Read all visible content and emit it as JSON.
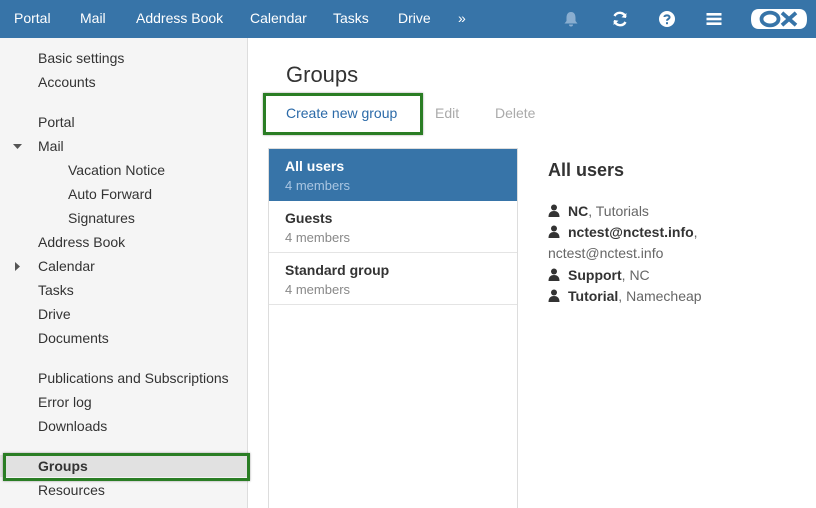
{
  "topnav": {
    "items": [
      "Portal",
      "Mail",
      "Address Book",
      "Calendar",
      "Tasks",
      "Drive"
    ],
    "more": "»"
  },
  "topicons": [
    "bell-icon",
    "refresh-icon",
    "help-icon",
    "menu-icon"
  ],
  "brand": {
    "logo": "OX",
    "bar_color": "#3774a8",
    "accent": "#2b6aa8",
    "highlight": "#2a7d24"
  },
  "sidebar": {
    "items": [
      "Basic settings",
      "Accounts",
      "Portal",
      "Mail",
      "Vacation Notice",
      "Auto Forward",
      "Signatures",
      "Address Book",
      "Calendar",
      "Tasks",
      "Drive",
      "Documents",
      "Publications and Subscriptions",
      "Error log",
      "Downloads",
      "Groups",
      "Resources"
    ],
    "selected": "Groups"
  },
  "main": {
    "title": "Groups",
    "toolbar": {
      "create": "Create new group",
      "edit": "Edit",
      "delete": "Delete"
    },
    "groups": [
      {
        "name": "All users",
        "count": "4 members"
      },
      {
        "name": "Guests",
        "count": "4 members"
      },
      {
        "name": "Standard group",
        "count": "4 members"
      }
    ],
    "detail": {
      "title": "All users",
      "members": [
        {
          "name": "NC",
          "sep": ",",
          "sub": "Tutorials"
        },
        {
          "name": "nctest@nctest.info",
          "sep": ",",
          "sub": "nctest@nctest.info"
        },
        {
          "name": "Support",
          "sep": ",",
          "sub": "NC"
        },
        {
          "name": "Tutorial",
          "sep": ",",
          "sub": "Namecheap"
        }
      ]
    }
  }
}
